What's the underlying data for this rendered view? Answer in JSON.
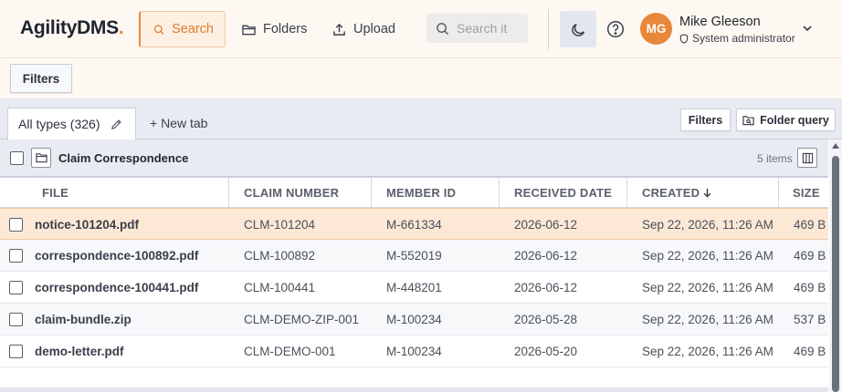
{
  "header": {
    "logo_main": "AgilityDMS",
    "logo_dot": ".",
    "nav": {
      "search": "Search",
      "folders": "Folders",
      "upload": "Upload"
    },
    "search_placeholder": "Search it",
    "user": {
      "initials": "MG",
      "name": "Mike Gleeson",
      "role": "System administrator"
    }
  },
  "filter_bar": {
    "filters_label": "Filters"
  },
  "tabs": {
    "active_label": "All types (326)",
    "new_tab_label": "+ New tab",
    "filters_button": "Filters",
    "folder_query_button": "Folder query"
  },
  "folder": {
    "name": "Claim Correspondence",
    "item_count": "5 items"
  },
  "table": {
    "columns": {
      "file": "FILE",
      "claim_number": "CLAIM NUMBER",
      "member_id": "MEMBER ID",
      "received_date": "RECEIVED DATE",
      "created": "CREATED",
      "size": "SIZE"
    },
    "rows": [
      {
        "file": "notice-101204.pdf",
        "claim_number": "CLM-101204",
        "member_id": "M-661334",
        "received_date": "2026-06-12",
        "created": "Sep 22, 2026, 11:26 AM",
        "size": "469 B"
      },
      {
        "file": "correspondence-100892.pdf",
        "claim_number": "CLM-100892",
        "member_id": "M-552019",
        "received_date": "2026-06-12",
        "created": "Sep 22, 2026, 11:26 AM",
        "size": "469 B"
      },
      {
        "file": "correspondence-100441.pdf",
        "claim_number": "CLM-100441",
        "member_id": "M-448201",
        "received_date": "2026-06-12",
        "created": "Sep 22, 2026, 11:26 AM",
        "size": "469 B"
      },
      {
        "file": "claim-bundle.zip",
        "claim_number": "CLM-DEMO-ZIP-001",
        "member_id": "M-100234",
        "received_date": "2026-05-28",
        "created": "Sep 22, 2026, 11:26 AM",
        "size": "537 B"
      },
      {
        "file": "demo-letter.pdf",
        "claim_number": "CLM-DEMO-001",
        "member_id": "M-100234",
        "received_date": "2026-05-20",
        "created": "Sep 22, 2026, 11:26 AM",
        "size": "469 B"
      }
    ]
  },
  "colors": {
    "accent": "#e8873a",
    "selected_row": "#fde8d6",
    "header_bg": "#fdf8f2",
    "toolbar_bg": "#e8ecf2"
  },
  "icons": {
    "search": "search-icon",
    "folders": "folder-icon",
    "upload": "upload-icon",
    "theme": "moon-icon",
    "help": "help-icon",
    "role": "shield-icon",
    "user_menu": "chevron-down-icon",
    "edit_tab": "pencil-icon",
    "columns": "columns-icon",
    "sort": "arrow-down-icon"
  }
}
